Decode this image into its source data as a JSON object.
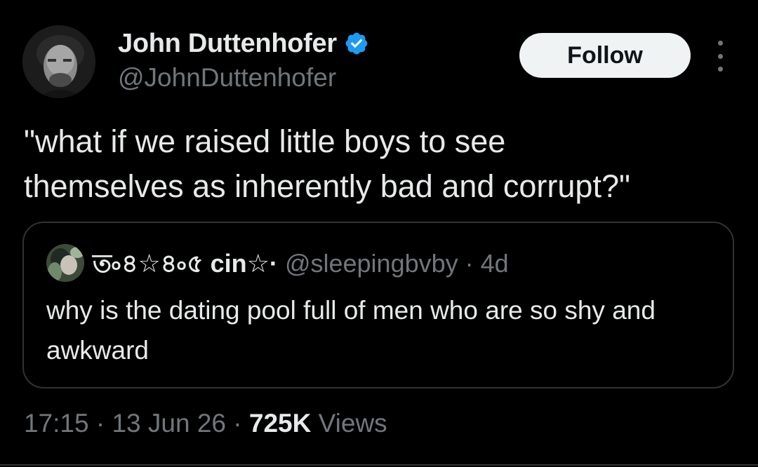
{
  "author": {
    "display_name": "John Duttenhofer",
    "handle": "@JohnDuttenhofer",
    "verified_icon": "verified-badge-icon",
    "verified_color": "#1d9bf0"
  },
  "actions": {
    "follow_label": "Follow",
    "more_icon": "more-vertical-icon"
  },
  "tweet": {
    "text": "\"what if we raised little boys to see\nthemselves as inherently bad and corrupt?\""
  },
  "quote": {
    "display_name": "ত৹৪☆৪৹৫ cin☆·",
    "handle": "@sleepingbvby",
    "separator": " · ",
    "time": "4d",
    "text": "why is the dating pool full of men who are so shy and awkward"
  },
  "meta": {
    "time": "17:15",
    "separator": " · ",
    "date": "13 Jun 26",
    "views_count": "725K",
    "views_label": "Views"
  },
  "colors": {
    "background": "#000000",
    "text_primary": "#e7e9ea",
    "text_secondary": "#71767b",
    "border": "#2f3336",
    "follow_bg": "#eff3f4",
    "follow_text": "#0f1419"
  }
}
